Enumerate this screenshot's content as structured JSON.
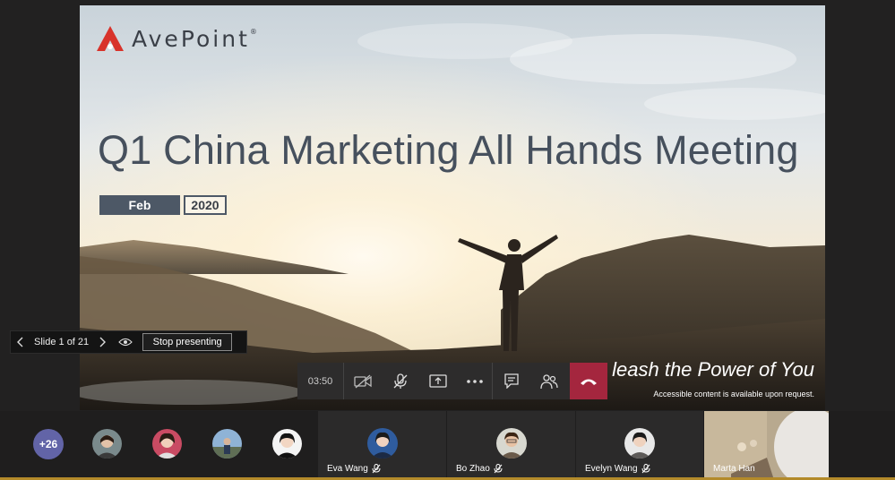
{
  "slide": {
    "logo_text": "AvePoint",
    "logo_mark": "®",
    "title": "Q1 China Marketing All Hands Meeting",
    "month": "Feb",
    "year": "2020",
    "tagline": "leash the Power of You",
    "accessibility_note": "Accessible content is available upon request."
  },
  "presenter_bar": {
    "slide_counter": "Slide 1 of 21",
    "stop_label": "Stop presenting",
    "icons": [
      "chevron-left-icon",
      "chevron-right-icon",
      "eye-icon"
    ]
  },
  "call_controls": {
    "timer": "03:50",
    "buttons": [
      "camera-off-icon",
      "mic-off-icon",
      "share-screen-icon",
      "more-icon",
      "chat-icon",
      "participants-icon",
      "hang-up-icon"
    ],
    "hangup_color": "#a4263e"
  },
  "participants": {
    "overflow_count": "+26",
    "tiles": [
      {
        "name": "Eva Wang",
        "muted": true
      },
      {
        "name": "Bo Zhao",
        "muted": true
      },
      {
        "name": "Evelyn Wang",
        "muted": true
      },
      {
        "name": "Marta Han",
        "muted": false
      }
    ]
  },
  "colors": {
    "accent": "#6264a7",
    "brand_red": "#d8332b",
    "slide_text": "#46505d"
  }
}
